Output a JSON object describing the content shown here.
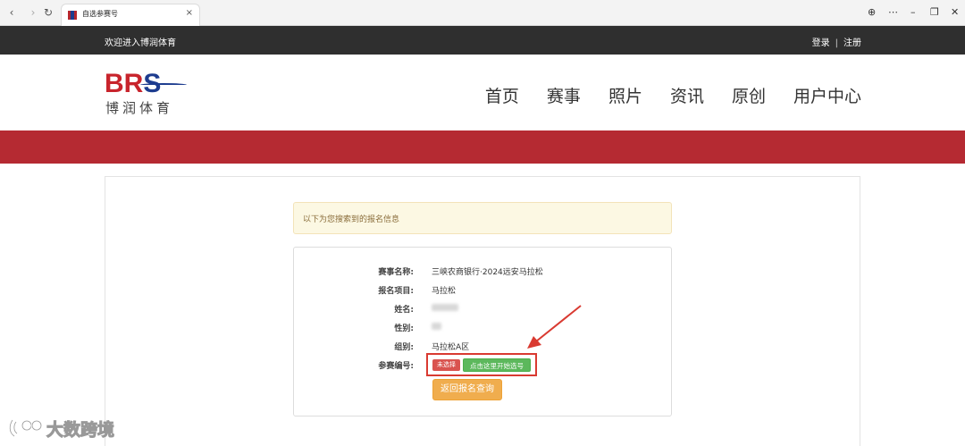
{
  "browser": {
    "tab_title": "自选参赛号",
    "tab_close": "×",
    "back": "‹",
    "forward": "›",
    "reload": "↻",
    "globe": "⊕",
    "more": "⋯",
    "minimize": "–",
    "restore": "❐",
    "close": "✕"
  },
  "topbar": {
    "welcome": "欢迎进入博润体育",
    "login": "登录",
    "separator": "|",
    "register": "注册"
  },
  "logo": {
    "letter_b": "B",
    "letter_r": "R",
    "letter_s": "S",
    "chinese": "博润体育"
  },
  "nav": [
    "首页",
    "赛事",
    "照片",
    "资讯",
    "原创",
    "用户中心"
  ],
  "alert": "以下为您搜索到的报名信息",
  "info": {
    "event_label": "赛事名称:",
    "event_value": "三峡农商银行·2024远安马拉松",
    "project_label": "报名项目:",
    "project_value": "马拉松",
    "name_label": "姓名:",
    "gender_label": "性别:",
    "group_label": "组别:",
    "group_value": "马拉松A区",
    "bib_label": "参赛编号:",
    "bib_status": "未选择",
    "select_button": "点击这里开始选号",
    "back_button": "返回报名查询"
  },
  "watermark": "大数跨境",
  "colors": {
    "brand_red": "#b52a32",
    "brand_blue": "#1d3c8f",
    "topbar_bg": "#2f2f2f",
    "status_red": "#d9534f",
    "success_green": "#5cb85c",
    "warning_orange": "#f0ad4e",
    "annotation_red": "#d93a31"
  }
}
